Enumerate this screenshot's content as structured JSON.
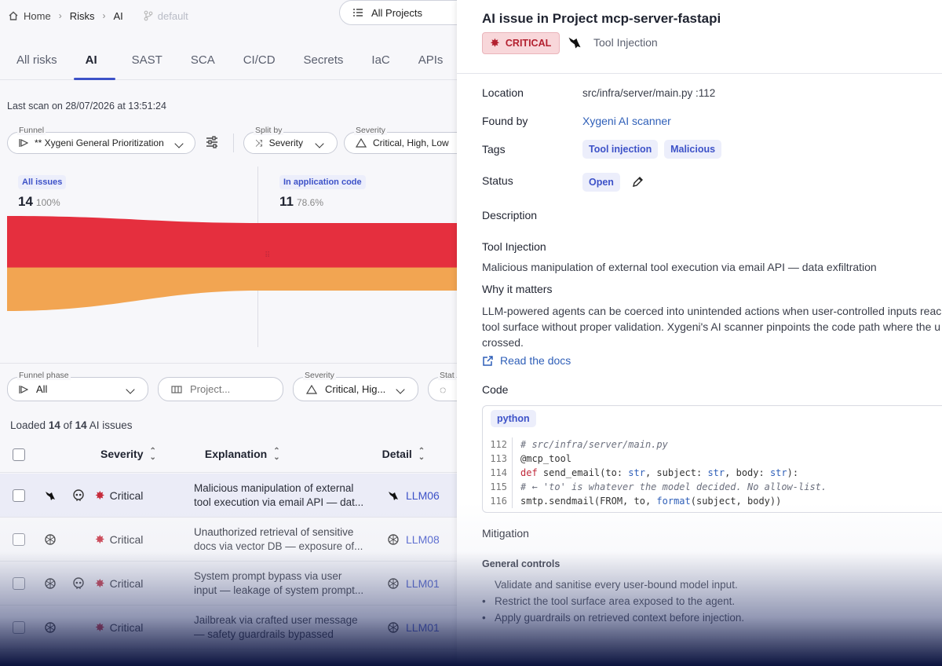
{
  "breadcrumb": {
    "home": "Home",
    "risks": "Risks",
    "current": "AI",
    "branch": "default"
  },
  "project_select": {
    "value": "All Projects"
  },
  "tabs": [
    "All risks",
    "AI",
    "SAST",
    "SCA",
    "CI/CD",
    "Secrets",
    "IaC",
    "APIs"
  ],
  "active_tab": "AI",
  "last_scan": "Last scan on 28/07/2026 at 13:51:24",
  "filters": {
    "funnel": {
      "label": "Funnel",
      "value": "** Xygeni General Prioritization"
    },
    "split_by": {
      "label": "Split by",
      "value": "Severity"
    },
    "severity": {
      "label": "Severity",
      "value": "Critical, High, Low"
    }
  },
  "funnel": {
    "stages": [
      {
        "label": "All issues",
        "count": "14",
        "pct": "100%"
      },
      {
        "label": "In application code",
        "count": "11",
        "pct": "78.6%"
      }
    ],
    "colors": {
      "critical": "#e52f3e",
      "high": "#f2a552"
    }
  },
  "table_filters": {
    "phase": {
      "label": "Funnel phase",
      "value": "All"
    },
    "project": {
      "placeholder": "Project..."
    },
    "severity": {
      "label": "Severity",
      "value": "Critical, Hig..."
    },
    "status": {
      "label": "Stat"
    }
  },
  "loaded": {
    "prefix": "Loaded",
    "count": "14",
    "of": "of",
    "total": "14",
    "suffix": "AI issues"
  },
  "table": {
    "headers": {
      "severity": "Severity",
      "explanation": "Explanation",
      "detail": "Detail"
    },
    "rows": [
      {
        "icons": [
          "crow-icon",
          "skull-icon"
        ],
        "severity": "Critical",
        "expl1": "Malicious manipulation of external",
        "expl2": "tool execution via email API — dat...",
        "detail_icon": "crow-icon",
        "detail": "LLM06"
      },
      {
        "icons": [
          "openai-icon"
        ],
        "severity": "Critical",
        "expl1": "Unauthorized retrieval of sensitive",
        "expl2": "docs via vector DB — exposure of...",
        "detail_icon": "openai-icon",
        "detail": "LLM08"
      },
      {
        "icons": [
          "openai-icon",
          "skull-icon"
        ],
        "severity": "Critical",
        "expl1": "System prompt bypass via user",
        "expl2": "input — leakage of system prompt...",
        "detail_icon": "openai-icon",
        "detail": "LLM01"
      },
      {
        "icons": [
          "openai-icon"
        ],
        "severity": "Critical",
        "expl1": "Jailbreak via crafted user message",
        "expl2": "— safety guardrails bypassed",
        "detail_icon": "openai-icon",
        "detail": "LLM01"
      }
    ]
  },
  "detail": {
    "title": "AI issue in Project mcp-server-fastapi",
    "severity_badge": "CRITICAL",
    "type": "Tool Injection",
    "location_label": "Location",
    "location": "src/infra/server/main.py :112",
    "found_by_label": "Found by",
    "found_by": "Xygeni AI scanner",
    "tags_label": "Tags",
    "tags": [
      "Tool injection",
      "Malicious"
    ],
    "status_label": "Status",
    "status": "Open",
    "description_label": "Description",
    "desc_title": "Tool Injection",
    "desc_text": "Malicious manipulation of external tool execution via email API — data exfiltration",
    "why_title": "Why it matters",
    "why_lines": [
      "LLM-powered agents can be coerced into unintended actions when user-controlled inputs reac",
      "tool surface without proper validation. Xygeni's AI scanner pinpoints the code path where the u",
      "crossed."
    ],
    "docs_link": "Read the docs",
    "code_label": "Code",
    "code_lang": "python",
    "code": [
      {
        "ln": "112",
        "text": "# src/infra/server/main.py"
      },
      {
        "ln": "113",
        "text": "@mcp_tool"
      },
      {
        "ln": "114",
        "text": "def send_email(to: str, subject: str, body: str):"
      },
      {
        "ln": "115",
        "text": "# ← 'to' is whatever the model decided. No allow-list."
      },
      {
        "ln": "116",
        "text": "smtp.sendmail(FROM, to, format(subject, body))"
      }
    ],
    "mitigation_label": "Mitigation",
    "general_controls": "General controls",
    "mitigation_items": [
      "Validate and sanitise every user-bound model input.",
      "Restrict the tool surface area exposed to the agent.",
      "Apply guardrails on retrieved context before injection."
    ]
  }
}
